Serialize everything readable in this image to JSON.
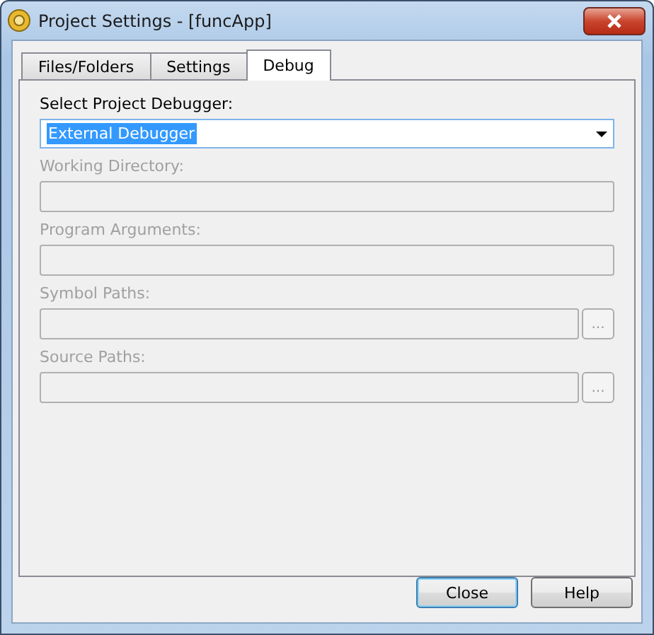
{
  "window": {
    "title": "Project Settings - [funcApp]"
  },
  "tabs": [
    {
      "label": "Files/Folders",
      "selected": false
    },
    {
      "label": "Settings",
      "selected": false
    },
    {
      "label": "Debug",
      "selected": true
    }
  ],
  "debugger": {
    "label": "Select Project Debugger:",
    "value": "External Debugger",
    "highlighted": true
  },
  "fields": [
    {
      "kind": "text",
      "label": "Working Directory:",
      "disabled": true
    },
    {
      "kind": "text",
      "label": "Program Arguments:",
      "disabled": true
    },
    {
      "kind": "path",
      "label": "Symbol Paths:",
      "disabled": true,
      "browse": "..."
    },
    {
      "kind": "path",
      "label": "Source Paths:",
      "disabled": true,
      "browse": "..."
    }
  ],
  "buttons": [
    {
      "label": "Close",
      "default": true
    },
    {
      "label": "Help",
      "default": false
    }
  ]
}
